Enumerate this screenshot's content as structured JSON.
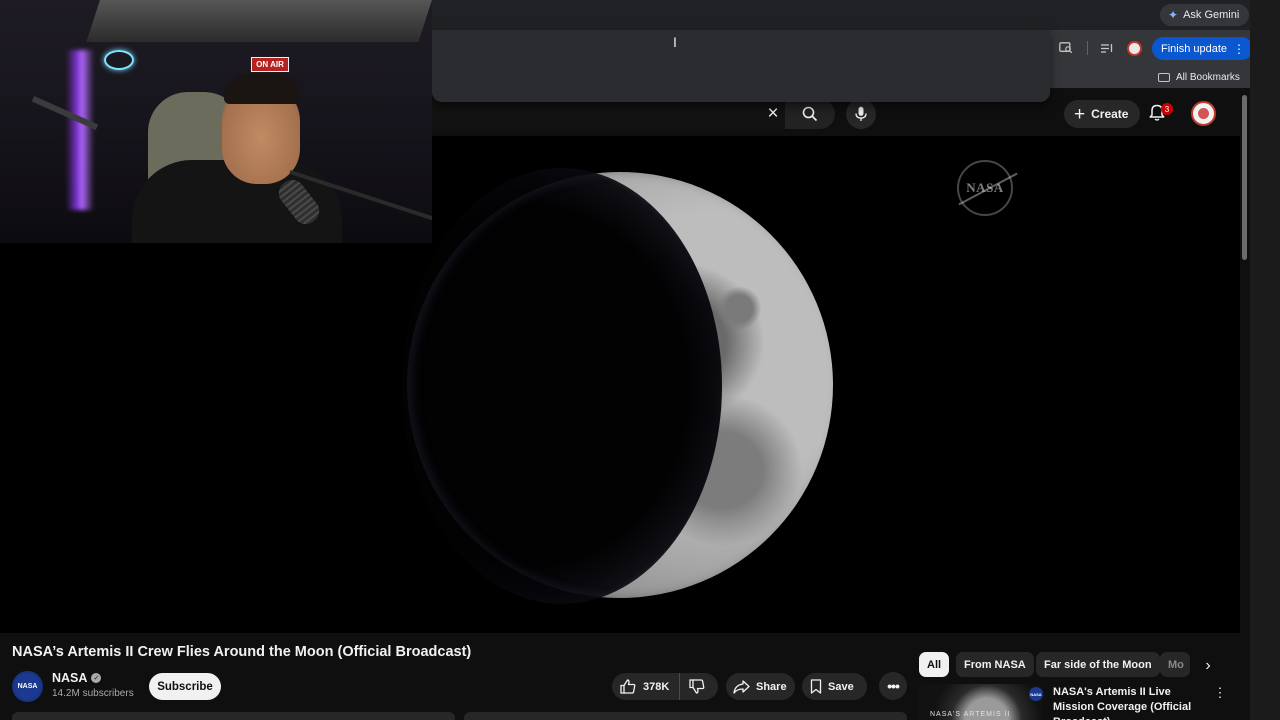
{
  "browser": {
    "ask_gemini_label": "Ask Gemini",
    "finish_update_label": "Finish update",
    "all_bookmarks_label": "All Bookmarks"
  },
  "webcam": {
    "on_air_sign": "ON AIR"
  },
  "masthead": {
    "create_label": "Create",
    "notification_count": "3"
  },
  "video": {
    "watermark_text": "NASA",
    "title": "NASA’s Artemis II Crew Flies Around the Moon (Official Broadcast)"
  },
  "channel": {
    "avatar_text": "NASA",
    "name": "NASA",
    "subscribers": "14.2M subscribers",
    "subscribe_label": "Subscribe"
  },
  "actions": {
    "like_count": "378K",
    "share_label": "Share",
    "save_label": "Save"
  },
  "chips": {
    "all": "All",
    "from_channel": "From NASA",
    "far_side": "Far side of the Moon",
    "truncated": "Mo"
  },
  "related": {
    "thumbnail_caption": "NASA'S ARTEMIS II",
    "channel_badge": "NASA",
    "title": "NASA's Artemis II Live Mission Coverage (Official Broadcast)"
  },
  "icons": {
    "gemini": "sparkle-icon",
    "search": "search-icon",
    "mic": "mic-icon",
    "bell": "bell-icon",
    "like": "thumbs-up-icon",
    "dislike": "thumbs-down-icon",
    "share": "share-icon",
    "save": "bookmark-icon",
    "more": "more-horizontal-icon"
  },
  "colors": {
    "finish_update_bg": "#0b57d0",
    "notification_badge": "#cc0000",
    "page_bg": "#0f0f0f"
  }
}
